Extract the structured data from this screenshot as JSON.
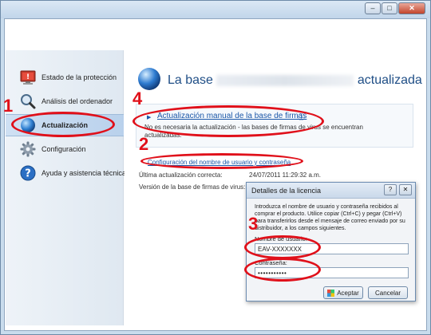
{
  "window": {
    "minimize_glyph": "–",
    "maximize_glyph": "□",
    "close_glyph": "✕"
  },
  "sidebar": {
    "items": [
      {
        "label": "Estado de la protección",
        "icon": "warning-monitor-icon"
      },
      {
        "label": "Análisis del ordenador",
        "icon": "magnifier-icon"
      },
      {
        "label": "Actualización",
        "icon": "globe-icon"
      },
      {
        "label": "Configuración",
        "icon": "gear-icon"
      },
      {
        "label": "Ayuda y asistencia técnica",
        "icon": "help-icon"
      }
    ]
  },
  "main": {
    "title_prefix": "La base",
    "title_suffix": "actualizada",
    "manual_update_link": "Actualización manual de la base de firmas",
    "info_glyph": "ⓘ",
    "no_update_needed": "No es necesaria la actualización - las bases de firmas de virus se encuentran actualizadas.",
    "config_link": "Configuración del nombre de usuario y contraseña",
    "last_update_label": "Última actualización correcta:",
    "last_update_value": "24/07/2011 11:29:32 a.m.",
    "db_version_label": "Versión de la base de firmas de virus:"
  },
  "dialog": {
    "title": "Detalles de la licencia",
    "help_glyph": "?",
    "close_glyph": "✕",
    "description": "Introduzca el nombre de usuario y contraseña recibidos al comprar el producto. Utilice copiar (Ctrl+C) y pegar (Ctrl+V) para transferirlos desde el mensaje de correo enviado por su distribuidor, a los campos siguientes.",
    "username_label": "Nombre de usuario:",
    "username_value": "EAV-XXXXXXX",
    "password_label": "Contraseña:",
    "password_value": "•••••••••••",
    "accept_label": "Aceptar",
    "cancel_label": "Cancelar"
  },
  "annotations": {
    "marker_1": "1",
    "marker_2": "2",
    "marker_3": "3",
    "marker_4": "4",
    "color": "#e0101a"
  },
  "colors": {
    "accent_blue": "#1f4e86",
    "link_blue": "#1b57a8"
  }
}
